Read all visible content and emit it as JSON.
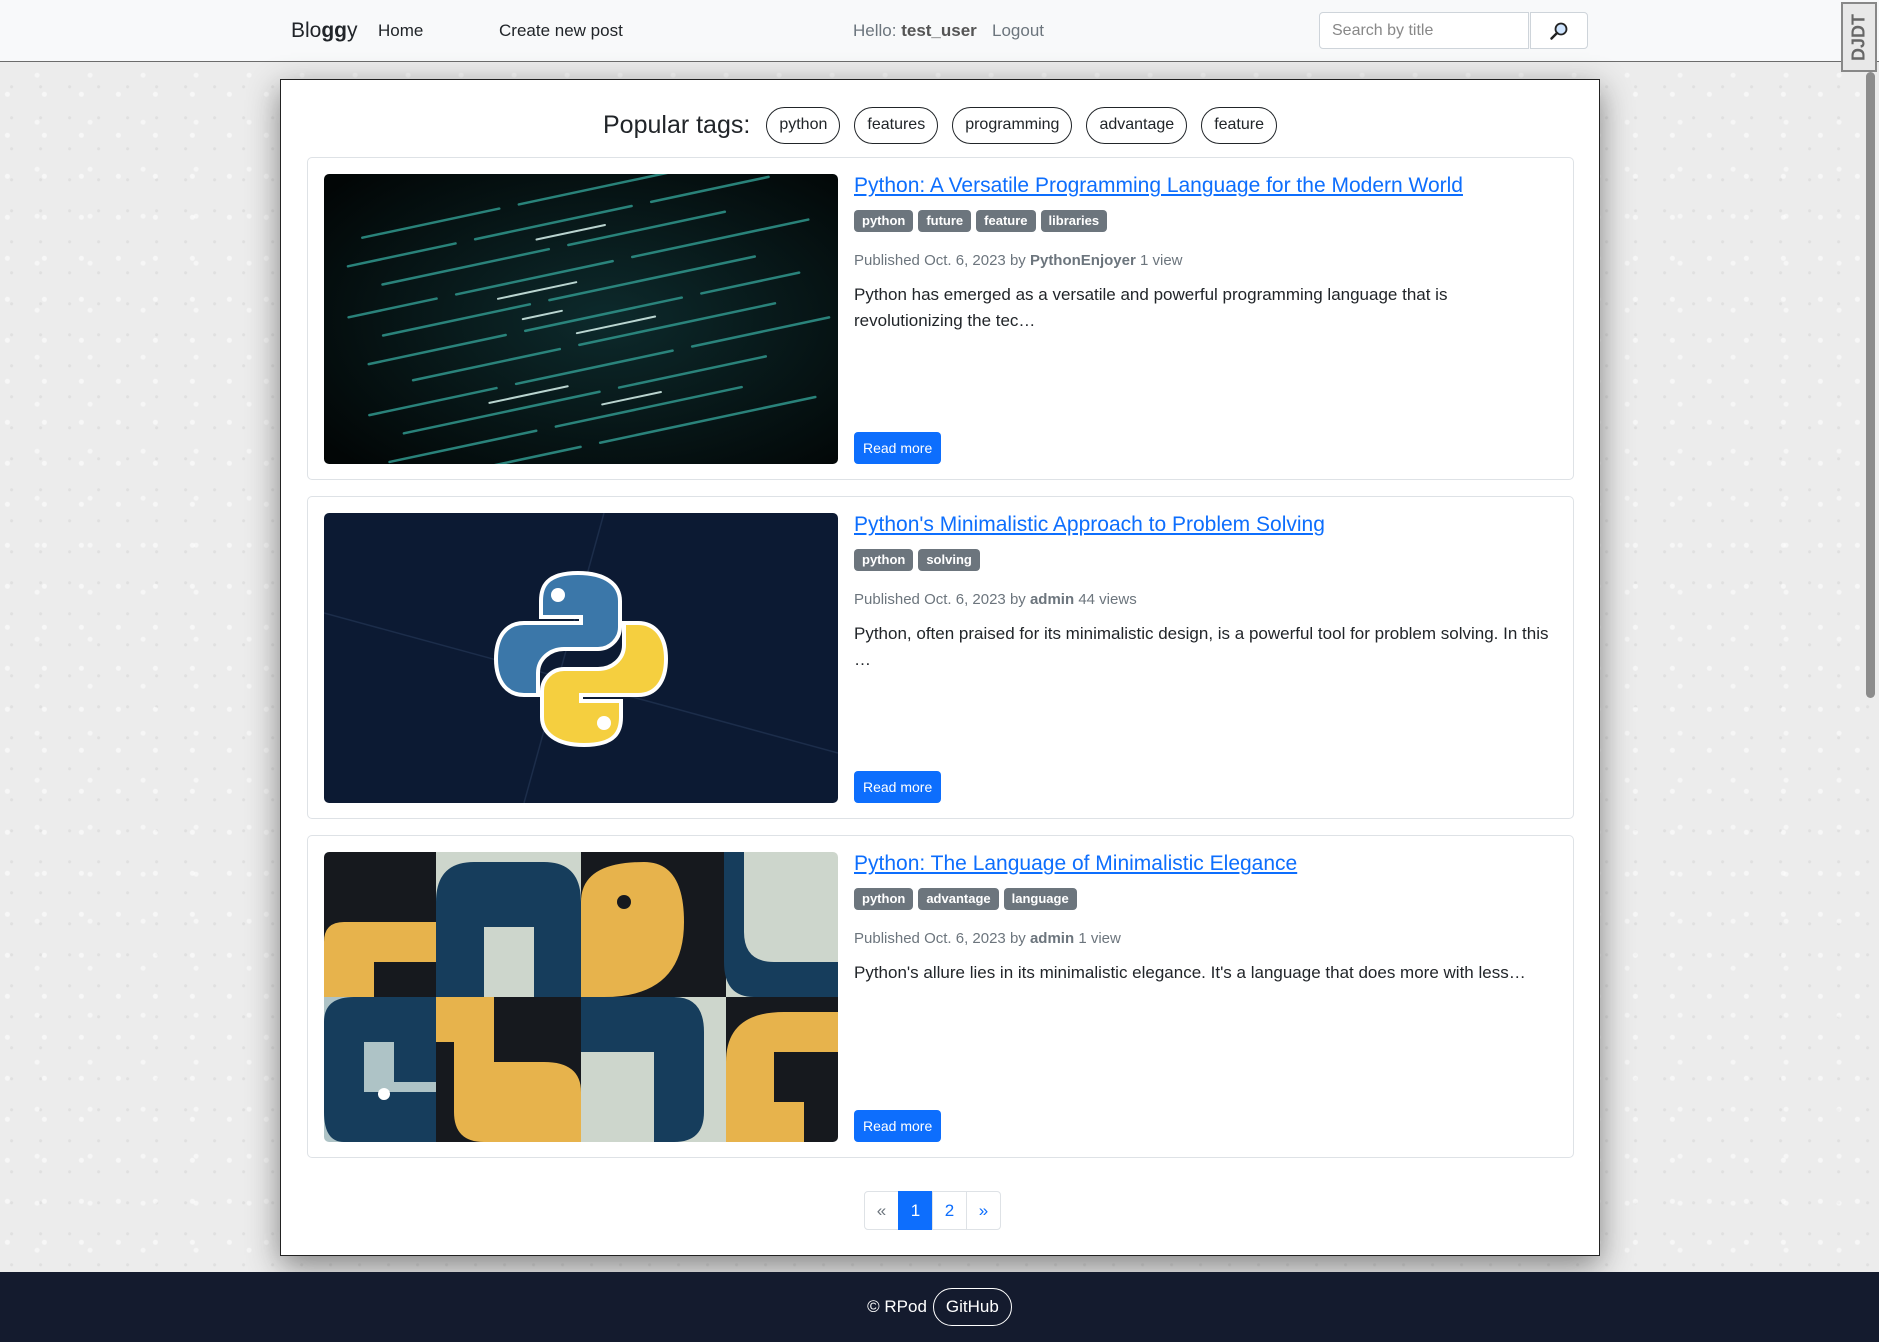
{
  "navbar": {
    "brand_pre": "Blo",
    "brand_bold": "gg",
    "brand_post": "y",
    "home_label": "Home",
    "create_label": "Create new post",
    "hello_label": "Hello:",
    "username": "test_user",
    "logout_label": "Logout",
    "search_placeholder": "Search by title",
    "corner_badge": "DJDT"
  },
  "popular_tags": {
    "title": "Popular tags:",
    "tags": [
      "python",
      "features",
      "programming",
      "advantage",
      "feature"
    ]
  },
  "posts": [
    {
      "title": "Python: A Versatile Programming Language for the Modern World",
      "tags": [
        "python",
        "future",
        "feature",
        "libraries"
      ],
      "published_prefix": "Published",
      "date": "Oct. 6, 2023",
      "by": "by",
      "author": "PythonEnjoyer",
      "views": "1 view",
      "excerpt": "Python has emerged as a versatile and powerful programming language that is revolutionizing the tec…",
      "read_more": "Read more",
      "image_icon": "code-screen-image"
    },
    {
      "title": "Python's Minimalistic Approach to Problem Solving",
      "tags": [
        "python",
        "solving"
      ],
      "published_prefix": "Published",
      "date": "Oct. 6, 2023",
      "by": "by",
      "author": "admin",
      "views": "44 views",
      "excerpt": "Python, often praised for its minimalistic design, is a powerful tool for problem solving. In this …",
      "read_more": "Read more",
      "image_icon": "python-logo-image"
    },
    {
      "title": "Python: The Language of Minimalistic Elegance",
      "tags": [
        "python",
        "advantage",
        "language"
      ],
      "published_prefix": "Published",
      "date": "Oct. 6, 2023",
      "by": "by",
      "author": "admin",
      "views": "1 view",
      "excerpt": "Python's allure lies in its minimalistic elegance. It's a language that does more with less…",
      "read_more": "Read more",
      "image_icon": "python-pattern-image"
    }
  ],
  "pagination": {
    "prev": "«",
    "pages": [
      "1",
      "2"
    ],
    "active_page": "1",
    "next": "»"
  },
  "footer": {
    "copyright": "© RPod",
    "github_label": "GitHub"
  },
  "colors": {
    "primary": "#0d6efd",
    "badge": "#6c757d",
    "footer_bg": "#141b2e"
  }
}
